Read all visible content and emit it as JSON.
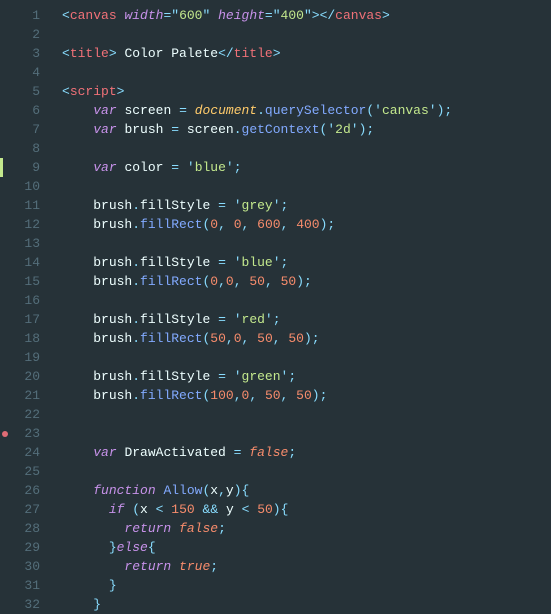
{
  "lines": [
    {
      "num": "1",
      "html": "<span class='p'>&lt;</span><span class='tg'>canvas</span> <span class='at'>width</span><span class='p'>=</span><span class='p'>\"</span><span class='st'>600</span><span class='p'>\"</span> <span class='at'>height</span><span class='p'>=</span><span class='p'>\"</span><span class='st'>400</span><span class='p'>\"</span><span class='p'>&gt;&lt;/</span><span class='tg'>canvas</span><span class='p'>&gt;</span>"
    },
    {
      "num": "2",
      "html": ""
    },
    {
      "num": "3",
      "html": "<span class='p'>&lt;</span><span class='tg'>title</span><span class='p'>&gt;</span><span class='tx'> Color Palete</span><span class='p'>&lt;/</span><span class='tg'>title</span><span class='p'>&gt;</span>"
    },
    {
      "num": "4",
      "html": ""
    },
    {
      "num": "5",
      "html": "<span class='p'>&lt;</span><span class='tg'>script</span><span class='p'>&gt;</span>"
    },
    {
      "num": "6",
      "html": "    <span class='kw'>var</span> <span class='tx'>screen</span> <span class='p'>=</span> <span class='ob'>document</span><span class='p'>.</span><span class='fn'>querySelector</span><span class='p'>(</span><span class='p'>'</span><span class='st'>canvas</span><span class='p'>'</span><span class='p'>)</span><span class='p'>;</span>"
    },
    {
      "num": "7",
      "html": "    <span class='kw'>var</span> <span class='tx'>brush</span> <span class='p'>=</span> <span class='tx'>screen</span><span class='p'>.</span><span class='fn'>getContext</span><span class='p'>(</span><span class='p'>'</span><span class='st'>2d</span><span class='p'>'</span><span class='p'>)</span><span class='p'>;</span>"
    },
    {
      "num": "8",
      "html": ""
    },
    {
      "num": "9",
      "html": "    <span class='kw'>var</span> <span class='tx'>color</span> <span class='p'>=</span> <span class='p'>'</span><span class='st'>blue</span><span class='p'>'</span><span class='p'>;</span>",
      "mod": true
    },
    {
      "num": "10",
      "html": ""
    },
    {
      "num": "11",
      "html": "    <span class='tx'>brush</span><span class='p'>.</span><span class='tx'>fillStyle</span> <span class='p'>=</span> <span class='p'>'</span><span class='st'>grey</span><span class='p'>'</span><span class='p'>;</span>"
    },
    {
      "num": "12",
      "html": "    <span class='tx'>brush</span><span class='p'>.</span><span class='fn'>fillRect</span><span class='p'>(</span><span class='nm'>0</span><span class='p'>,</span> <span class='nm'>0</span><span class='p'>,</span> <span class='nm'>600</span><span class='p'>,</span> <span class='nm'>400</span><span class='p'>)</span><span class='p'>;</span>"
    },
    {
      "num": "13",
      "html": ""
    },
    {
      "num": "14",
      "html": "    <span class='tx'>brush</span><span class='p'>.</span><span class='tx'>fillStyle</span> <span class='p'>=</span> <span class='p'>'</span><span class='st'>blue</span><span class='p'>'</span><span class='p'>;</span>"
    },
    {
      "num": "15",
      "html": "    <span class='tx'>brush</span><span class='p'>.</span><span class='fn'>fillRect</span><span class='p'>(</span><span class='nm'>0</span><span class='p'>,</span><span class='nm'>0</span><span class='p'>,</span> <span class='nm'>50</span><span class='p'>,</span> <span class='nm'>50</span><span class='p'>)</span><span class='p'>;</span>"
    },
    {
      "num": "16",
      "html": ""
    },
    {
      "num": "17",
      "html": "    <span class='tx'>brush</span><span class='p'>.</span><span class='tx'>fillStyle</span> <span class='p'>=</span> <span class='p'>'</span><span class='st'>red</span><span class='p'>'</span><span class='p'>;</span>"
    },
    {
      "num": "18",
      "html": "    <span class='tx'>brush</span><span class='p'>.</span><span class='fn'>fillRect</span><span class='p'>(</span><span class='nm'>50</span><span class='p'>,</span><span class='nm'>0</span><span class='p'>,</span> <span class='nm'>50</span><span class='p'>,</span> <span class='nm'>50</span><span class='p'>)</span><span class='p'>;</span>"
    },
    {
      "num": "19",
      "html": ""
    },
    {
      "num": "20",
      "html": "    <span class='tx'>brush</span><span class='p'>.</span><span class='tx'>fillStyle</span> <span class='p'>=</span> <span class='p'>'</span><span class='st'>green</span><span class='p'>'</span><span class='p'>;</span>"
    },
    {
      "num": "21",
      "html": "    <span class='tx'>brush</span><span class='p'>.</span><span class='fn'>fillRect</span><span class='p'>(</span><span class='nm'>100</span><span class='p'>,</span><span class='nm'>0</span><span class='p'>,</span> <span class='nm'>50</span><span class='p'>,</span> <span class='nm'>50</span><span class='p'>)</span><span class='p'>;</span>"
    },
    {
      "num": "22",
      "html": ""
    },
    {
      "num": "23",
      "html": "",
      "dot": true
    },
    {
      "num": "24",
      "html": "    <span class='kw'>var</span> <span class='tx'>DrawActivated</span> <span class='p'>=</span> <span class='bo'>false</span><span class='p'>;</span>"
    },
    {
      "num": "25",
      "html": ""
    },
    {
      "num": "26",
      "html": "    <span class='kw'>function</span> <span class='fn'>Allow</span><span class='p'>(</span><span class='tx'>x</span><span class='p'>,</span><span class='tx'>y</span><span class='p'>)</span><span class='p'>{</span>"
    },
    {
      "num": "27",
      "html": "      <span class='kw'>if</span> <span class='p'>(</span><span class='tx'>x</span> <span class='p'>&lt;</span> <span class='nm'>150</span> <span class='p'>&amp;&amp;</span> <span class='tx'>y</span> <span class='p'>&lt;</span> <span class='nm'>50</span><span class='p'>)</span><span class='p'>{</span>"
    },
    {
      "num": "28",
      "html": "        <span class='kw'>return</span> <span class='bo'>false</span><span class='p'>;</span>"
    },
    {
      "num": "29",
      "html": "      <span class='p'>}</span><span class='kw'>else</span><span class='p'>{</span>"
    },
    {
      "num": "30",
      "html": "        <span class='kw'>return</span> <span class='bo'>true</span><span class='p'>;</span>"
    },
    {
      "num": "31",
      "html": "      <span class='p'>}</span>"
    },
    {
      "num": "32",
      "html": "    <span class='p'>}</span>"
    }
  ]
}
